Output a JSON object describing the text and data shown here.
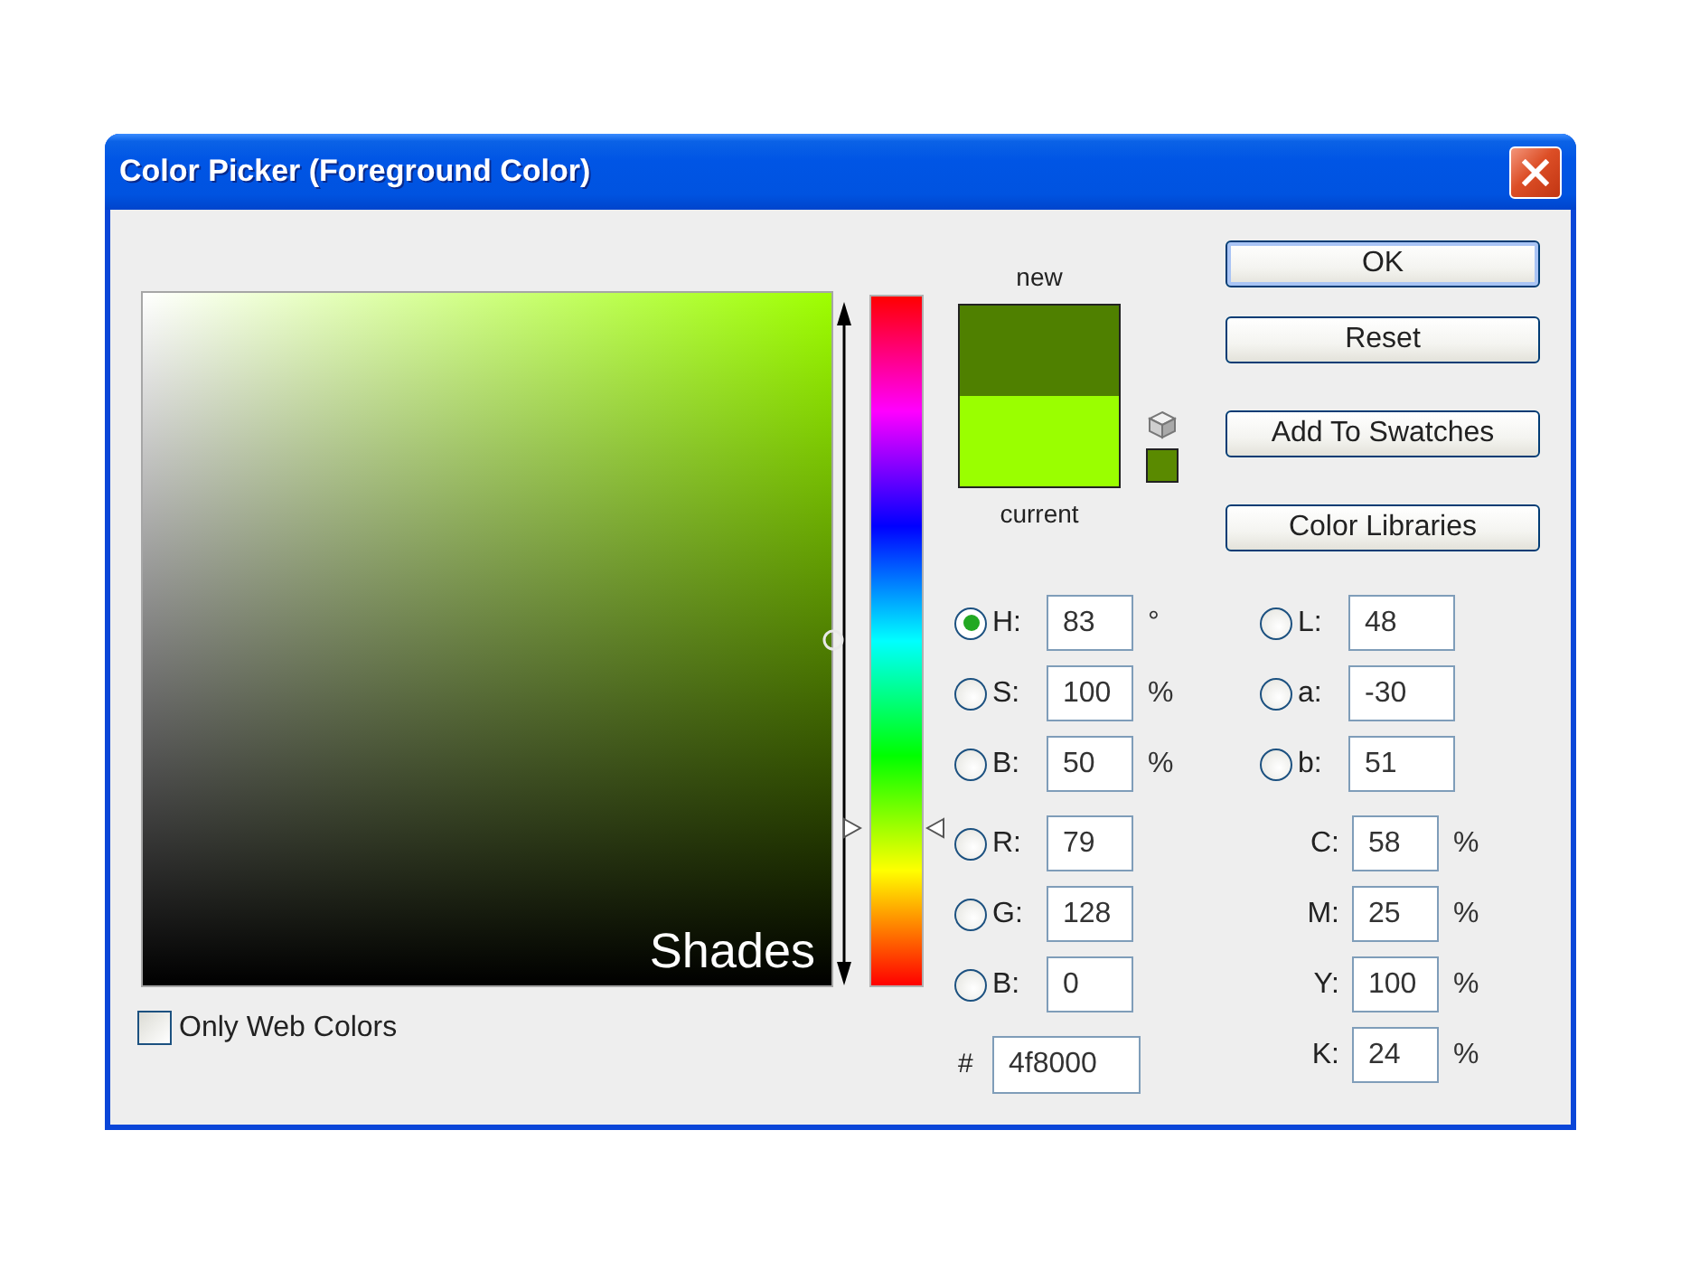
{
  "window": {
    "title": "Color Picker (Foreground Color)"
  },
  "color_field": {
    "label": "Shades"
  },
  "hue_slider": {
    "level": 0.23
  },
  "swatches": [
    {
      "kind": "new",
      "label": "new",
      "color": "#4f8000"
    },
    {
      "kind": "current",
      "label": "current",
      "color": "#9aff00"
    },
    {
      "kind": "web_safe",
      "color": "#5a8a00"
    }
  ],
  "buttons": [
    {
      "label": "OK",
      "default": true
    },
    {
      "label": "Reset",
      "default": false
    },
    {
      "label": "Add To Swatches",
      "default": false
    },
    {
      "label": "Color Libraries",
      "default": false
    }
  ],
  "hsb_rgb_fields": [
    {
      "label": "H:",
      "value": "83",
      "unit": "°",
      "selected": true
    },
    {
      "label": "S:",
      "value": "100",
      "unit": "%",
      "selected": false
    },
    {
      "label": "B:",
      "value": "50",
      "unit": "%",
      "selected": false
    },
    {
      "label": "R:",
      "value": "79",
      "selected": false
    },
    {
      "label": "G:",
      "value": "128",
      "selected": false
    },
    {
      "label": "B:",
      "value": "0",
      "selected": false
    }
  ],
  "hex_field": {
    "label": "#",
    "value": "4f8000"
  },
  "lab_fields": [
    {
      "label": "L:",
      "value": "48",
      "selected": false
    },
    {
      "label": "a:",
      "value": "-30",
      "selected": false
    },
    {
      "label": "b:",
      "value": "51",
      "selected": false
    }
  ],
  "cmyk_fields": [
    {
      "label": "C:",
      "value": "58",
      "unit": "%"
    },
    {
      "label": "M:",
      "value": "25",
      "unit": "%"
    },
    {
      "label": "Y:",
      "value": "100",
      "unit": "%"
    },
    {
      "label": "K:",
      "value": "24",
      "unit": "%"
    }
  ],
  "web_colors_checkbox": {
    "label": "Only Web Colors",
    "checked": false
  }
}
